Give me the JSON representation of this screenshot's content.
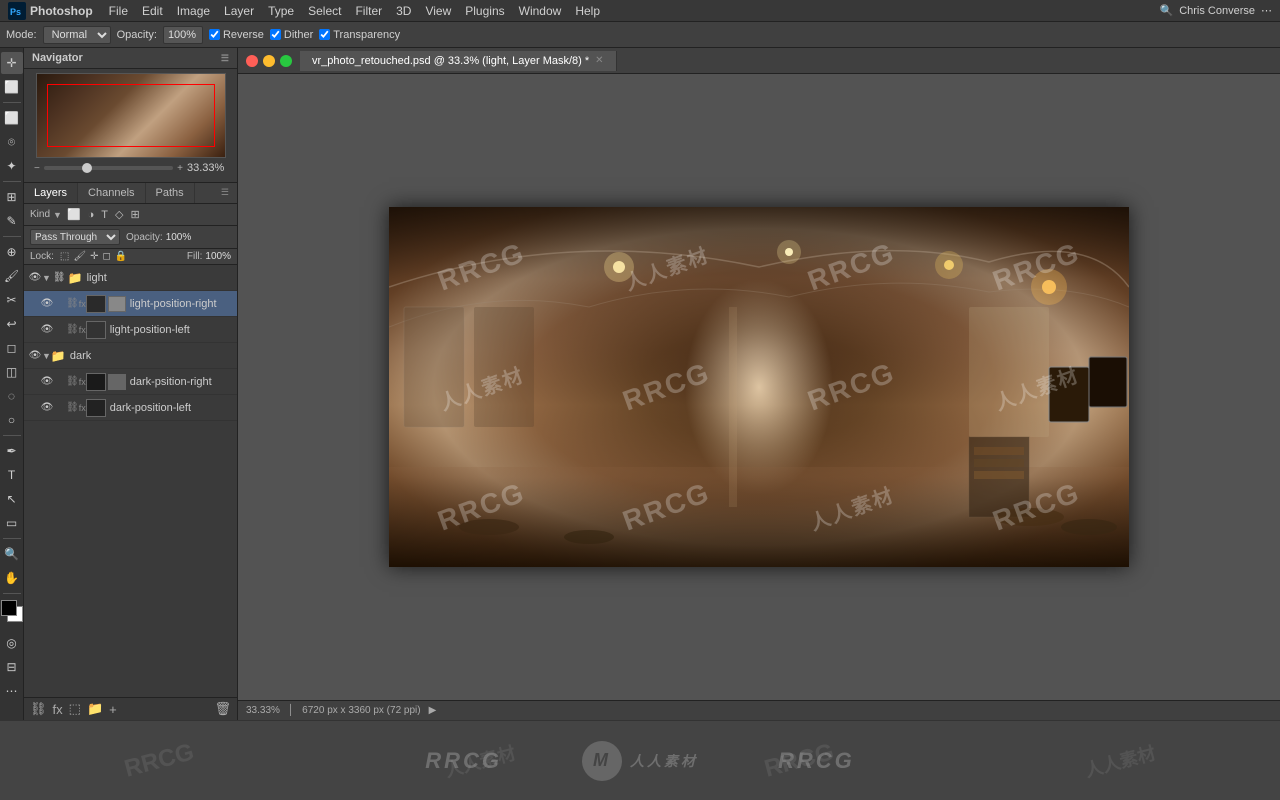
{
  "app": {
    "name": "Photoshop",
    "menu": [
      "Photoshop",
      "File",
      "Edit",
      "Image",
      "Layer",
      "Type",
      "Select",
      "Filter",
      "3D",
      "View",
      "Plugins",
      "Window",
      "Help"
    ]
  },
  "menubar": {
    "user": "Chris Converse"
  },
  "optionsbar": {
    "mode_label": "Mode:",
    "mode_value": "Normal",
    "opacity_label": "Opacity:",
    "opacity_value": "100%",
    "reverse_label": "Reverse",
    "dither_label": "Dither",
    "transparency_label": "Transparency"
  },
  "navigator": {
    "title": "Navigator",
    "zoom": "33.33%"
  },
  "layers_panel": {
    "tabs": [
      "Layers",
      "Channels",
      "Paths"
    ],
    "active_tab": "Layers",
    "kind_label": "Kind",
    "blend_mode": "Pass Through",
    "opacity_label": "Opacity:",
    "opacity_value": "100%",
    "fill_label": "Fill:",
    "fill_value": "100%",
    "lock_label": "Lock:",
    "layers": [
      {
        "id": "light",
        "name": "light",
        "type": "group",
        "visible": true,
        "expanded": true,
        "indent": 0,
        "selected": false
      },
      {
        "id": "light-pos-right",
        "name": "light-position-right",
        "type": "layer",
        "visible": true,
        "indent": 1,
        "selected": true
      },
      {
        "id": "light-pos-left",
        "name": "light-position-left",
        "type": "layer",
        "visible": true,
        "indent": 1,
        "selected": false
      },
      {
        "id": "dark",
        "name": "dark",
        "type": "group",
        "visible": true,
        "expanded": true,
        "indent": 0,
        "selected": false
      },
      {
        "id": "dark-pos-right",
        "name": "dark-psition-right",
        "type": "layer",
        "visible": true,
        "indent": 1,
        "selected": false
      },
      {
        "id": "dark-pos-left",
        "name": "dark-position-left",
        "type": "layer",
        "visible": true,
        "indent": 1,
        "selected": false
      }
    ]
  },
  "canvas": {
    "tab_title": "vr_photo_retouched.psd @ 33.3% (light, Layer Mask/8) *",
    "zoom": "33.33%",
    "dimensions": "6720 px x 3360 px (72 ppi)"
  },
  "statusbar": {
    "zoom": "33.33%",
    "dimensions": "6720 px x 3360 px (72 ppi)",
    "arrow": "▶"
  },
  "watermark": {
    "text1": "RRCG",
    "text2": "人人素材",
    "bottom_text1": "RRCG",
    "bottom_text2": "人人素材",
    "bottom_text3": "RRCG"
  }
}
